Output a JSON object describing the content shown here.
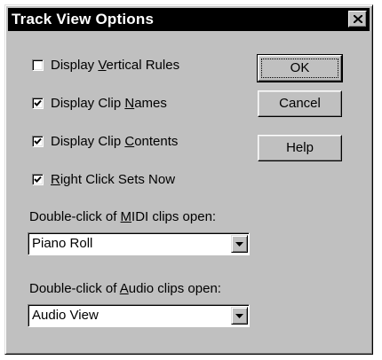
{
  "window": {
    "title": "Track View Options",
    "close_glyph": "×"
  },
  "options": [
    {
      "pre": "Display ",
      "mnemonic": "V",
      "post": "ertical Rules",
      "checked": false
    },
    {
      "pre": "Display Clip ",
      "mnemonic": "N",
      "post": "ames",
      "checked": true
    },
    {
      "pre": "Display Clip ",
      "mnemonic": "C",
      "post": "ontents",
      "checked": true
    },
    {
      "pre": "",
      "mnemonic": "R",
      "post": "ight Click Sets Now",
      "checked": true
    }
  ],
  "buttons": {
    "ok_label": "OK",
    "cancel_label": "Cancel",
    "help_label": "Help"
  },
  "midi": {
    "label_pre": "Double-click of ",
    "label_mnemonic": "M",
    "label_post": "IDI clips open:",
    "selected": "Piano Roll"
  },
  "audio": {
    "label_pre": "Double-click of ",
    "label_mnemonic": "A",
    "label_post": "udio clips open:",
    "selected": "Audio View"
  },
  "icons": {
    "close": "close-icon",
    "check": "checkmark-icon",
    "dropdown": "dropdown-arrow-icon"
  },
  "colors": {
    "dialog_face": "#c0c0c0",
    "titlebar": "#000000",
    "title_text": "#ffffff"
  }
}
